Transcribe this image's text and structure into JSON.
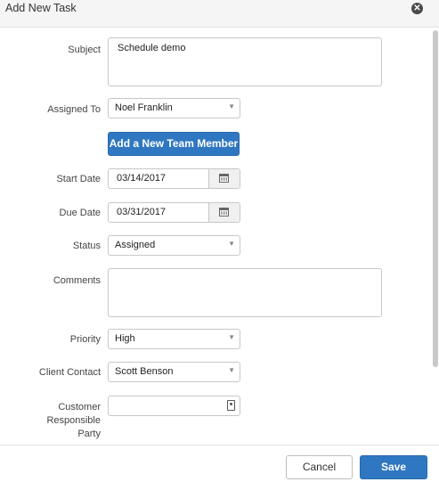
{
  "dialog": {
    "title": "Add New Task"
  },
  "form": {
    "subject": {
      "label": "Subject",
      "value": "Schedule demo"
    },
    "assigned_to": {
      "label": "Assigned To",
      "value": "Noel Franklin"
    },
    "add_member_button": "Add a New Team Member",
    "start_date": {
      "label": "Start Date",
      "value": "03/14/2017"
    },
    "due_date": {
      "label": "Due Date",
      "value": "03/31/2017"
    },
    "status": {
      "label": "Status",
      "value": "Assigned"
    },
    "comments": {
      "label": "Comments",
      "value": ""
    },
    "priority": {
      "label": "Priority",
      "value": "High"
    },
    "client_contact": {
      "label": "Client Contact",
      "value": "Scott Benson"
    },
    "customer_responsible_party": {
      "label_lines": [
        "Customer",
        "Responsible",
        "Party"
      ],
      "value": ""
    }
  },
  "footer": {
    "cancel_label": "Cancel",
    "save_label": "Save"
  },
  "icons": {
    "close": "close-circle-icon",
    "calendar": "calendar-icon",
    "dropdown": "chevron-down-icon",
    "contact": "contact-card-icon"
  }
}
